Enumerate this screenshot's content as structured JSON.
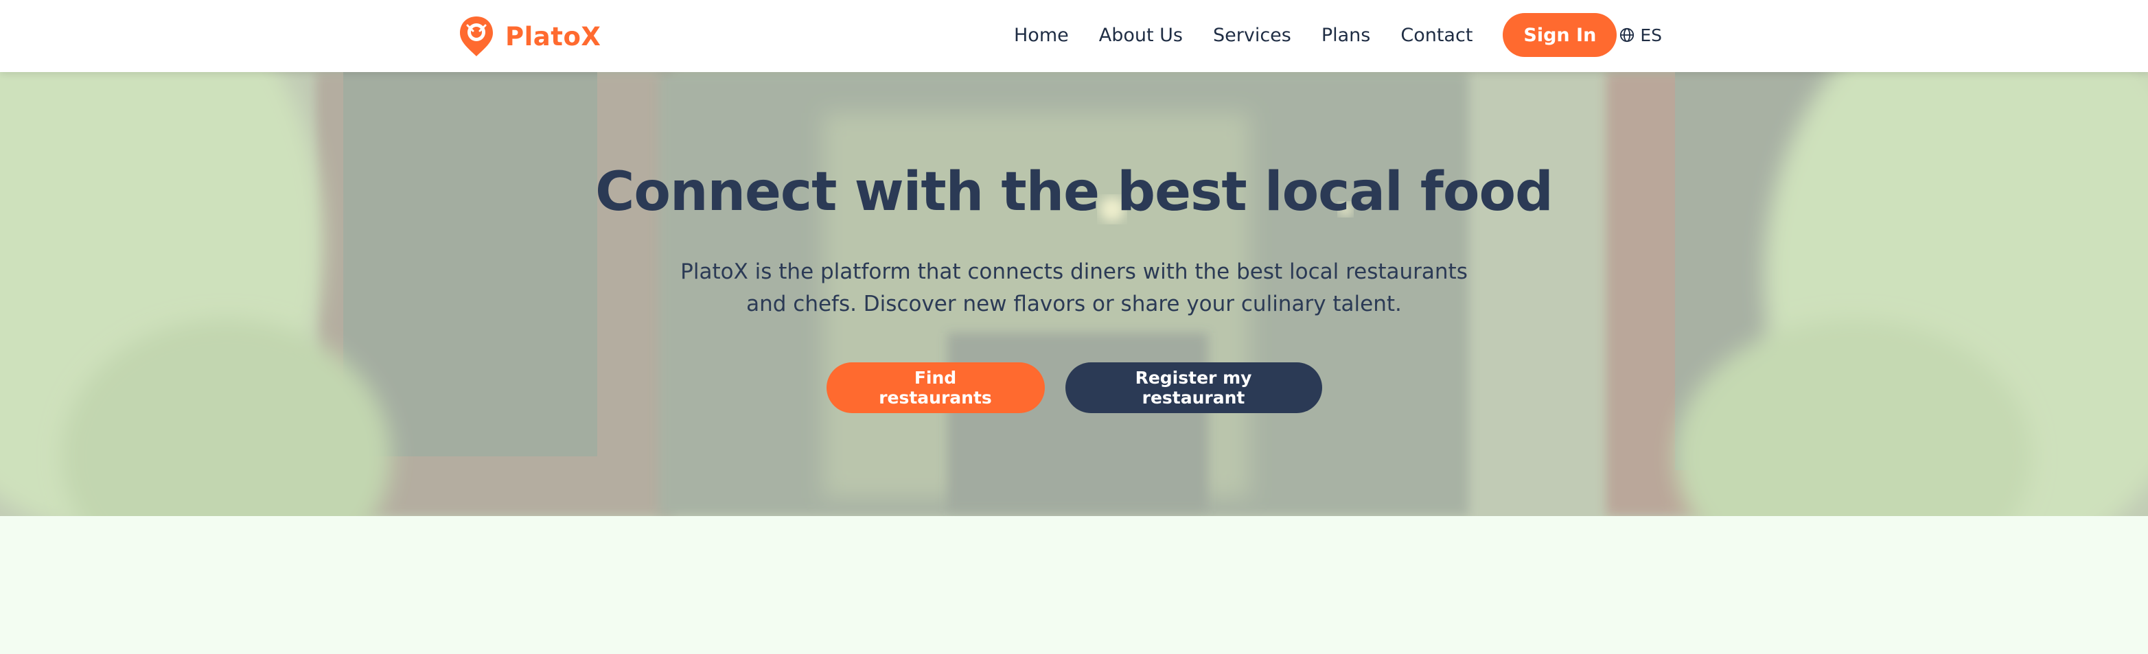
{
  "brand": {
    "name": "PlatoX",
    "logo_icon": "location-pin-plate-icon",
    "accent_color": "#ff6a2f"
  },
  "nav": {
    "links": [
      "Home",
      "About Us",
      "Services",
      "Plans",
      "Contact"
    ],
    "signin_label": "Sign In",
    "language_label": "ES",
    "language_icon": "globe-icon"
  },
  "hero": {
    "title": "Connect with the best local food",
    "subtitle": "PlatoX is the platform that connects diners with the best local restaurants and chefs. Discover new flavors or share your culinary talent.",
    "primary_button": "Find restaurants",
    "secondary_button": "Register my restaurant",
    "primary_color": "#ff6a2f",
    "secondary_color": "#2b3a55"
  }
}
